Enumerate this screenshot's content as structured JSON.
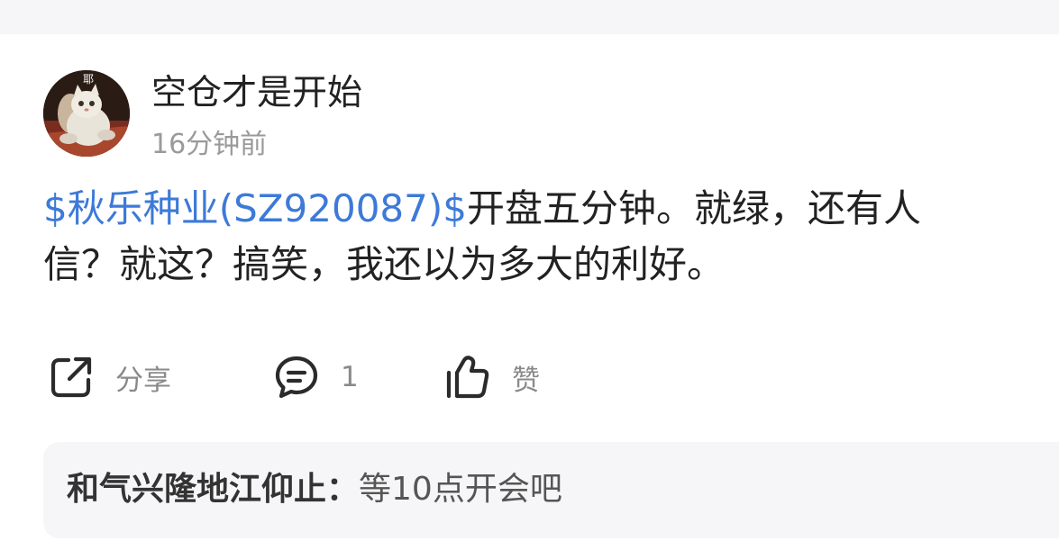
{
  "post": {
    "author": "空仓才是开始",
    "avatar_badge": "耶",
    "time": "16分钟前",
    "stock_tag": "$秋乐种业(SZ920087)$",
    "text_line1_rest": "开盘五分钟。就绿，还有人",
    "text_line2": "信？就这？搞笑，我还以为多大的利好。"
  },
  "actions": {
    "share_label": "分享",
    "comment_count": "1",
    "like_label": "赞"
  },
  "comment": {
    "author": "和气兴隆地江仰止",
    "separator": "：",
    "text": "等10点开会吧"
  },
  "icons": {
    "share": "share-icon",
    "comment": "comment-icon",
    "like": "thumbs-up-icon"
  },
  "colors": {
    "stock_link": "#3d7ad8",
    "text": "#222222",
    "muted": "#8a8a8a",
    "comment_bg": "#f6f6f8"
  }
}
